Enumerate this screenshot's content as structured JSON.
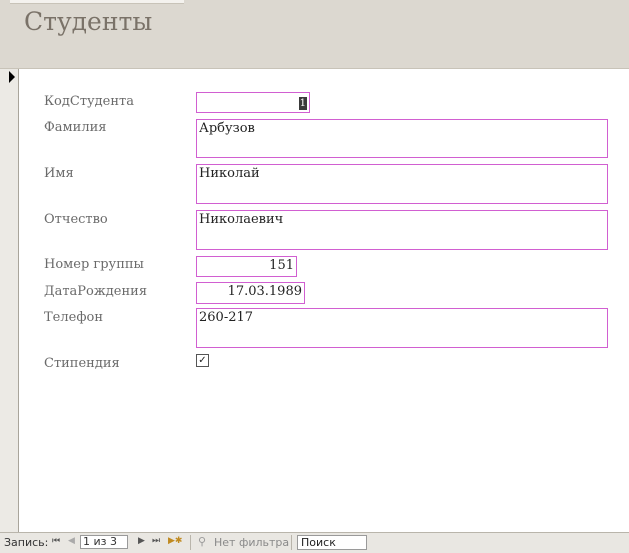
{
  "form": {
    "title": "Студенты"
  },
  "fields": {
    "id": {
      "label": "КодСтудента",
      "value": "1"
    },
    "surname": {
      "label": "Фамилия",
      "value": "Арбузов"
    },
    "name": {
      "label": "Имя",
      "value": "Николай"
    },
    "patronymic": {
      "label": "Отчество",
      "value": "Николаевич"
    },
    "group": {
      "label": "Номер группы",
      "value": "151"
    },
    "birthdate": {
      "label": "ДатаРождения",
      "value": "17.03.1989"
    },
    "phone": {
      "label": "Телефон",
      "value": "260-217"
    },
    "scholarship": {
      "label": "Стипендия",
      "checked": true,
      "mark": "✓"
    }
  },
  "navigation": {
    "record_label": "Запись:",
    "position": "1 из 3",
    "filter_label": "Нет фильтра",
    "search_placeholder": "Поиск",
    "icons": {
      "first": "⏮",
      "prev": "◀",
      "next": "▶",
      "last": "⏭",
      "new": "▶✱",
      "filter": "⚲"
    }
  },
  "colors": {
    "field_border": "#d15fd1",
    "header_bg": "#dcd8d0"
  }
}
